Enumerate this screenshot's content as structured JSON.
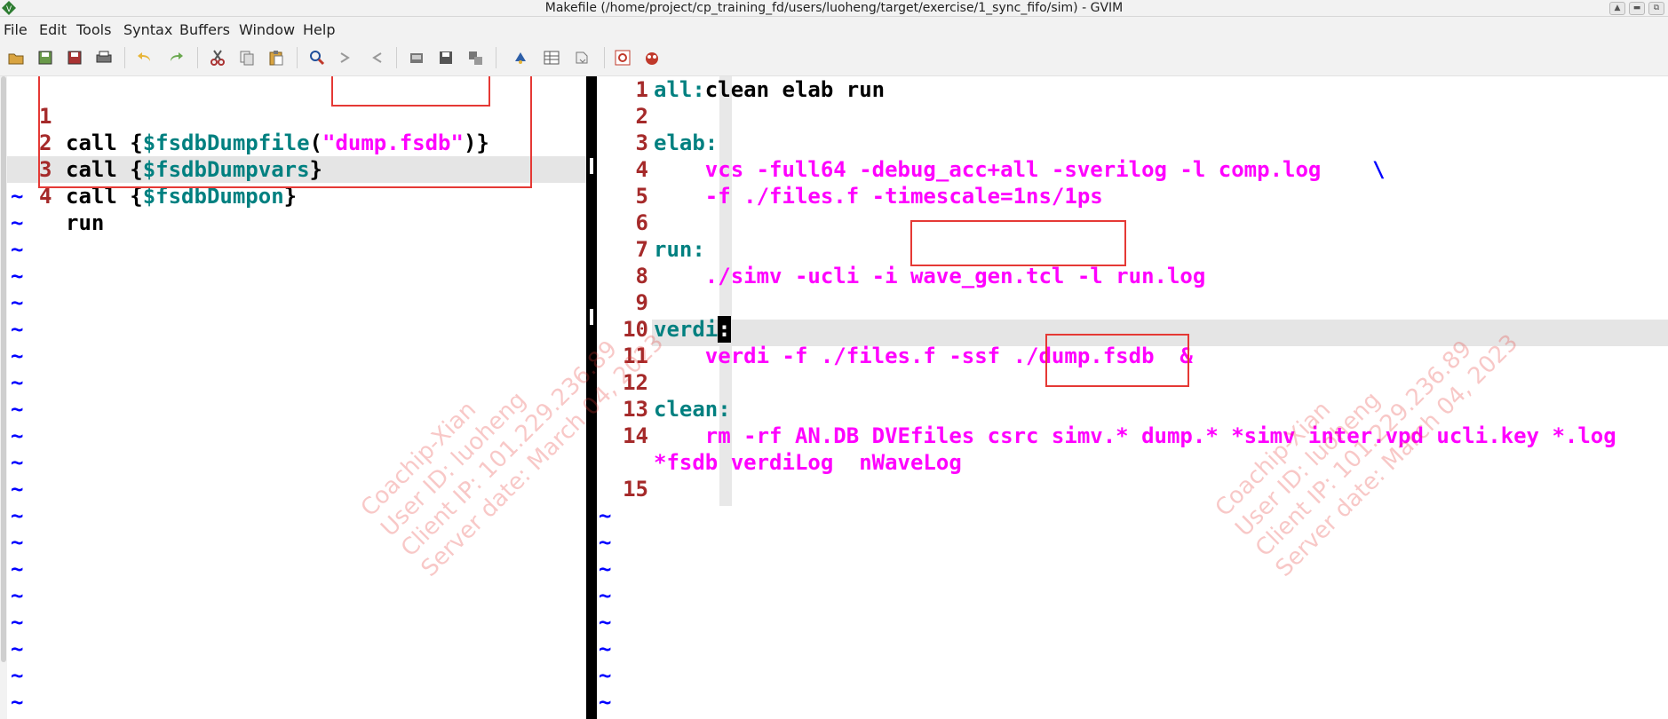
{
  "window": {
    "title": "Makefile (/home/project/cp_training_fd/users/luoheng/target/exercise/1_sync_fifo/sim) - GVIM",
    "controls": [
      "▲",
      "▬",
      "⧉"
    ]
  },
  "menubar": {
    "items": [
      {
        "label": "File"
      },
      {
        "label": "Edit"
      },
      {
        "label": "Tools"
      },
      {
        "label": "Syntax"
      },
      {
        "label": "Buffers"
      },
      {
        "label": "Window"
      },
      {
        "label": "Help"
      }
    ]
  },
  "toolbar": {
    "icons": [
      "open-icon",
      "save-icon",
      "save-all-icon",
      "print-icon",
      "undo-icon",
      "redo-icon",
      "cut-icon",
      "copy-icon",
      "paste-icon",
      "find-replace-icon",
      "find-next-icon",
      "find-prev-icon",
      "load-session-icon",
      "save-session-icon",
      "run-script-icon",
      "make-icon",
      "tags-icon",
      "jump-tag-icon",
      "help-icon",
      "find-help-icon"
    ]
  },
  "left_pane": {
    "lines": [
      {
        "n": "1",
        "parts": [
          {
            "t": "call {",
            "c": "black"
          },
          {
            "t": "$fsdbDumpfile",
            "c": "teal"
          },
          {
            "t": "(",
            "c": "black"
          },
          {
            "t": "\"dump.fsdb\"",
            "c": "mag"
          },
          {
            "t": ")}",
            "c": "black"
          }
        ]
      },
      {
        "n": "2",
        "parts": [
          {
            "t": "call {",
            "c": "black"
          },
          {
            "t": "$fsdbDumpvars",
            "c": "teal"
          },
          {
            "t": "}",
            "c": "black"
          }
        ]
      },
      {
        "n": "3",
        "parts": [
          {
            "t": "call {",
            "c": "black"
          },
          {
            "t": "$fsdbDumpon",
            "c": "teal"
          },
          {
            "t": "}",
            "c": "black"
          }
        ]
      },
      {
        "n": "4",
        "parts": [
          {
            "t": "run",
            "c": "black"
          }
        ]
      }
    ],
    "tilde": "~"
  },
  "right_pane": {
    "lines": [
      {
        "n": "1",
        "parts": [
          {
            "t": "all:",
            "c": "teal"
          },
          {
            "t": "clean elab run",
            "c": "black"
          }
        ]
      },
      {
        "n": "2",
        "parts": []
      },
      {
        "n": "3",
        "parts": [
          {
            "t": "elab:",
            "c": "teal"
          }
        ]
      },
      {
        "n": "4",
        "parts": [
          {
            "t": "    vcs -full64 -debug_acc+all -sverilog -l comp.log    ",
            "c": "mag"
          },
          {
            "t": "\\",
            "c": "blue"
          }
        ]
      },
      {
        "n": "5",
        "parts": [
          {
            "t": "    -f ./files.f -timescale=1ns/1ps",
            "c": "mag"
          }
        ]
      },
      {
        "n": "6",
        "parts": []
      },
      {
        "n": "7",
        "parts": [
          {
            "t": "run:",
            "c": "teal"
          }
        ]
      },
      {
        "n": "8",
        "parts": [
          {
            "t": "    ./simv -ucli -i wave_gen.tcl -l run.log",
            "c": "mag"
          }
        ]
      },
      {
        "n": "9",
        "parts": []
      },
      {
        "n": "10",
        "parts": [
          {
            "t": "verdi",
            "c": "teal"
          },
          {
            "t": ":",
            "c": "cursor"
          }
        ]
      },
      {
        "n": "11",
        "parts": [
          {
            "t": "    verdi -f ./files.f -ssf ./dump.fsdb  &",
            "c": "mag"
          }
        ]
      },
      {
        "n": "12",
        "parts": []
      },
      {
        "n": "13",
        "parts": [
          {
            "t": "clean:",
            "c": "teal"
          }
        ]
      },
      {
        "n": "14",
        "parts": [
          {
            "t": "    rm -rf AN.DB DVEfiles csrc simv.* dump.* *simv inter.vpd ucli.key *.log",
            "c": "mag"
          }
        ]
      },
      {
        "n": "",
        "parts": [
          {
            "t": "*fsdb verdiLog  nWaveLog",
            "c": "mag"
          }
        ]
      },
      {
        "n": "15",
        "parts": []
      }
    ],
    "tilde": "~"
  },
  "watermark": {
    "lines": [
      "Coachip-Xian",
      "User ID: luoheng",
      "Client IP: 101.229.236.89",
      "Server date: March 04, 2023"
    ]
  }
}
